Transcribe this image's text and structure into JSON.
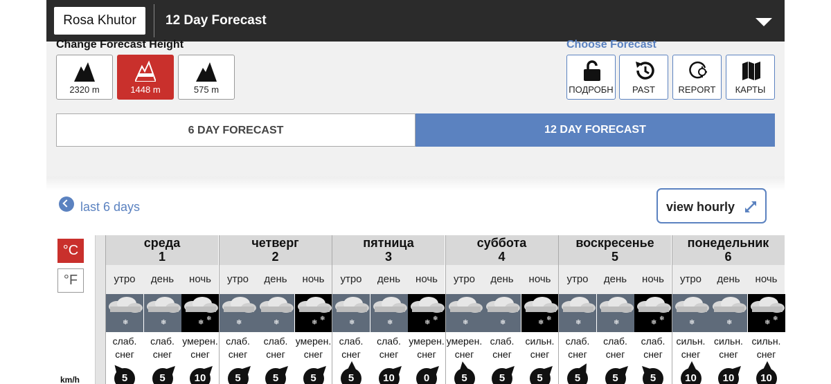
{
  "header": {
    "location": "Rosa Khutor",
    "title": "12 Day Forecast"
  },
  "height_selector": {
    "label": "Change Forecast Height",
    "options": [
      {
        "label": "2320 m",
        "active": false
      },
      {
        "label": "1448 m",
        "active": true
      },
      {
        "label": "575 m",
        "active": false
      }
    ]
  },
  "choose_forecast": {
    "label": "Choose Forecast",
    "options": [
      {
        "label": "ПОДРОБН",
        "icon": "unlock-icon"
      },
      {
        "label": "PAST",
        "icon": "history-icon"
      },
      {
        "label": "REPORT",
        "icon": "report-icon"
      },
      {
        "label": "КАРТЫ",
        "icon": "map-icon"
      }
    ]
  },
  "tabs": {
    "six_day": "6 DAY FORECAST",
    "twelve_day": "12 DAY FORECAST"
  },
  "nav": {
    "back_label": "last 6 days",
    "view_hourly": "view hourly"
  },
  "units": {
    "celsius": "°C",
    "fahrenheit": "°F",
    "wind": "km/h"
  },
  "colors": {
    "accent": "#5b82c0",
    "active_height": "#c9302c"
  },
  "days": [
    {
      "name": "среда",
      "num": "1",
      "periods": [
        {
          "label": "утро",
          "cond1": "слаб.",
          "cond2": "снег",
          "wind": "5",
          "dir": -40,
          "night": false
        },
        {
          "label": "день",
          "cond1": "слаб.",
          "cond2": "снег",
          "wind": "5",
          "dir": 45,
          "night": false
        },
        {
          "label": "ночь",
          "cond1": "умерен.",
          "cond2": "снег",
          "wind": "10",
          "dir": 45,
          "night": true
        }
      ]
    },
    {
      "name": "четверг",
      "num": "2",
      "periods": [
        {
          "label": "утро",
          "cond1": "слаб.",
          "cond2": "снег",
          "wind": "5",
          "dir": 45,
          "night": false
        },
        {
          "label": "день",
          "cond1": "слаб.",
          "cond2": "снег",
          "wind": "5",
          "dir": 45,
          "night": false
        },
        {
          "label": "ночь",
          "cond1": "умерен.",
          "cond2": "снег",
          "wind": "5",
          "dir": 45,
          "night": true
        }
      ]
    },
    {
      "name": "пятница",
      "num": "3",
      "periods": [
        {
          "label": "утро",
          "cond1": "слаб.",
          "cond2": "снег",
          "wind": "5",
          "dir": 0,
          "night": false
        },
        {
          "label": "день",
          "cond1": "слаб.",
          "cond2": "снег",
          "wind": "10",
          "dir": 45,
          "night": false
        },
        {
          "label": "ночь",
          "cond1": "умерен.",
          "cond2": "снег",
          "wind": "0",
          "dir": 45,
          "night": true
        }
      ]
    },
    {
      "name": "суббота",
      "num": "4",
      "periods": [
        {
          "label": "утро",
          "cond1": "умерен.",
          "cond2": "снег",
          "wind": "5",
          "dir": -10,
          "night": false
        },
        {
          "label": "день",
          "cond1": "слаб.",
          "cond2": "снег",
          "wind": "5",
          "dir": 45,
          "night": false
        },
        {
          "label": "ночь",
          "cond1": "сильн.",
          "cond2": "снег",
          "wind": "5",
          "dir": 45,
          "night": true
        }
      ]
    },
    {
      "name": "воскресенье",
      "num": "5",
      "periods": [
        {
          "label": "утро",
          "cond1": "слаб.",
          "cond2": "снег",
          "wind": "5",
          "dir": 30,
          "night": false
        },
        {
          "label": "день",
          "cond1": "слаб.",
          "cond2": "снег",
          "wind": "5",
          "dir": 45,
          "night": false
        },
        {
          "label": "ночь",
          "cond1": "слаб.",
          "cond2": "снег",
          "wind": "5",
          "dir": -45,
          "night": true
        }
      ]
    },
    {
      "name": "понедельник",
      "num": "6",
      "periods": [
        {
          "label": "утро",
          "cond1": "сильн.",
          "cond2": "снег",
          "wind": "10",
          "dir": 0,
          "night": false
        },
        {
          "label": "день",
          "cond1": "сильн.",
          "cond2": "снег",
          "wind": "10",
          "dir": 45,
          "night": false
        },
        {
          "label": "ночь",
          "cond1": "сильн.",
          "cond2": "снег",
          "wind": "10",
          "dir": 0,
          "night": true
        }
      ]
    }
  ]
}
